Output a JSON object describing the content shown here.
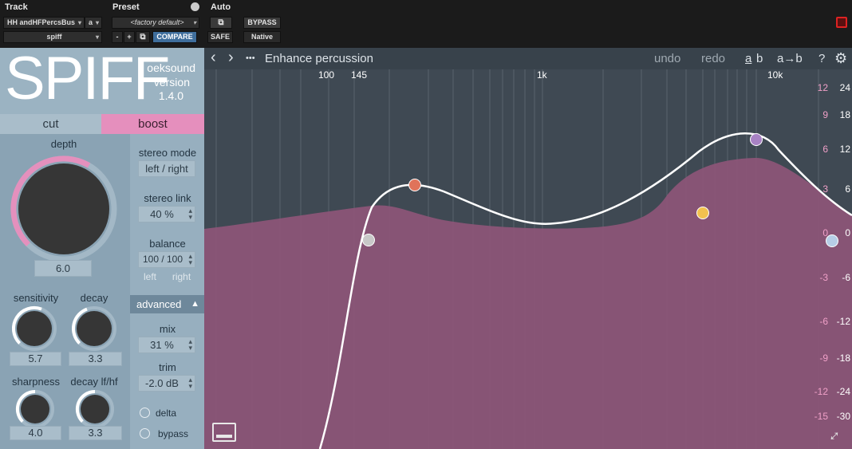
{
  "host": {
    "track_label": "Track",
    "preset_label": "Preset",
    "auto_label": "Auto",
    "track_name": "HH andHFPercsBus",
    "track_channel": "a",
    "insert_name": "spiff",
    "preset_name": "<factory default>",
    "minus": "-",
    "plus": "+",
    "compare": "COMPARE",
    "safe": "SAFE",
    "bypass": "BYPASS",
    "native": "Native"
  },
  "plugin": {
    "logo": "SPIFF",
    "vendor": "oeksound",
    "version_label": "version",
    "version": "1.4.0",
    "mode_cut": "cut",
    "mode_boost": "boost",
    "depth_label": "depth",
    "depth_value": "6.0",
    "depth_level": 0.5,
    "sensitivity_label": "sensitivity",
    "sensitivity_value": "5.7",
    "decay_label": "decay",
    "decay_value": "3.3",
    "sharpness_label": "sharpness",
    "sharpness_value": "4.0",
    "decay_lfhf_label": "decay lf/hf",
    "decay_lfhf_value": "3.3",
    "stereo_mode_label": "stereo mode",
    "stereo_mode_value": "left / right",
    "stereo_link_label": "stereo link",
    "stereo_link_value": "40 %",
    "balance_label": "balance",
    "balance_value": "100 / 100",
    "balance_left": "left",
    "balance_right": "right",
    "advanced_label": "advanced",
    "mix_label": "mix",
    "mix_value": "31 %",
    "trim_label": "trim",
    "trim_value": "-2.0 dB",
    "delta_label": "delta",
    "bypass_label": "bypass"
  },
  "toolbar": {
    "back": "‹",
    "forward": "›",
    "more": "•••",
    "preset_name": "Enhance percussion",
    "undo": "undo",
    "redo": "redo",
    "ab_a": "a",
    "ab_b": "b",
    "a_to_b": "a→b",
    "help": "?"
  },
  "graph": {
    "freq_labels": [
      "100",
      "145",
      "1k",
      "10k"
    ],
    "db_pink": [
      "12",
      "9",
      "6",
      "3",
      "0",
      "-3",
      "-6",
      "-9",
      "-12",
      "-15"
    ],
    "db_white": [
      "24",
      "18",
      "12",
      "6",
      "0",
      "-6",
      "-12",
      "-18",
      "-24",
      "-30"
    ],
    "colors": {
      "node_gray": "#c8c8c8",
      "node_orange": "#e0735a",
      "node_yellow": "#f2c14e",
      "node_purple": "#a882c4",
      "node_blue": "#b6cde6",
      "fill": "#8b5577"
    }
  }
}
